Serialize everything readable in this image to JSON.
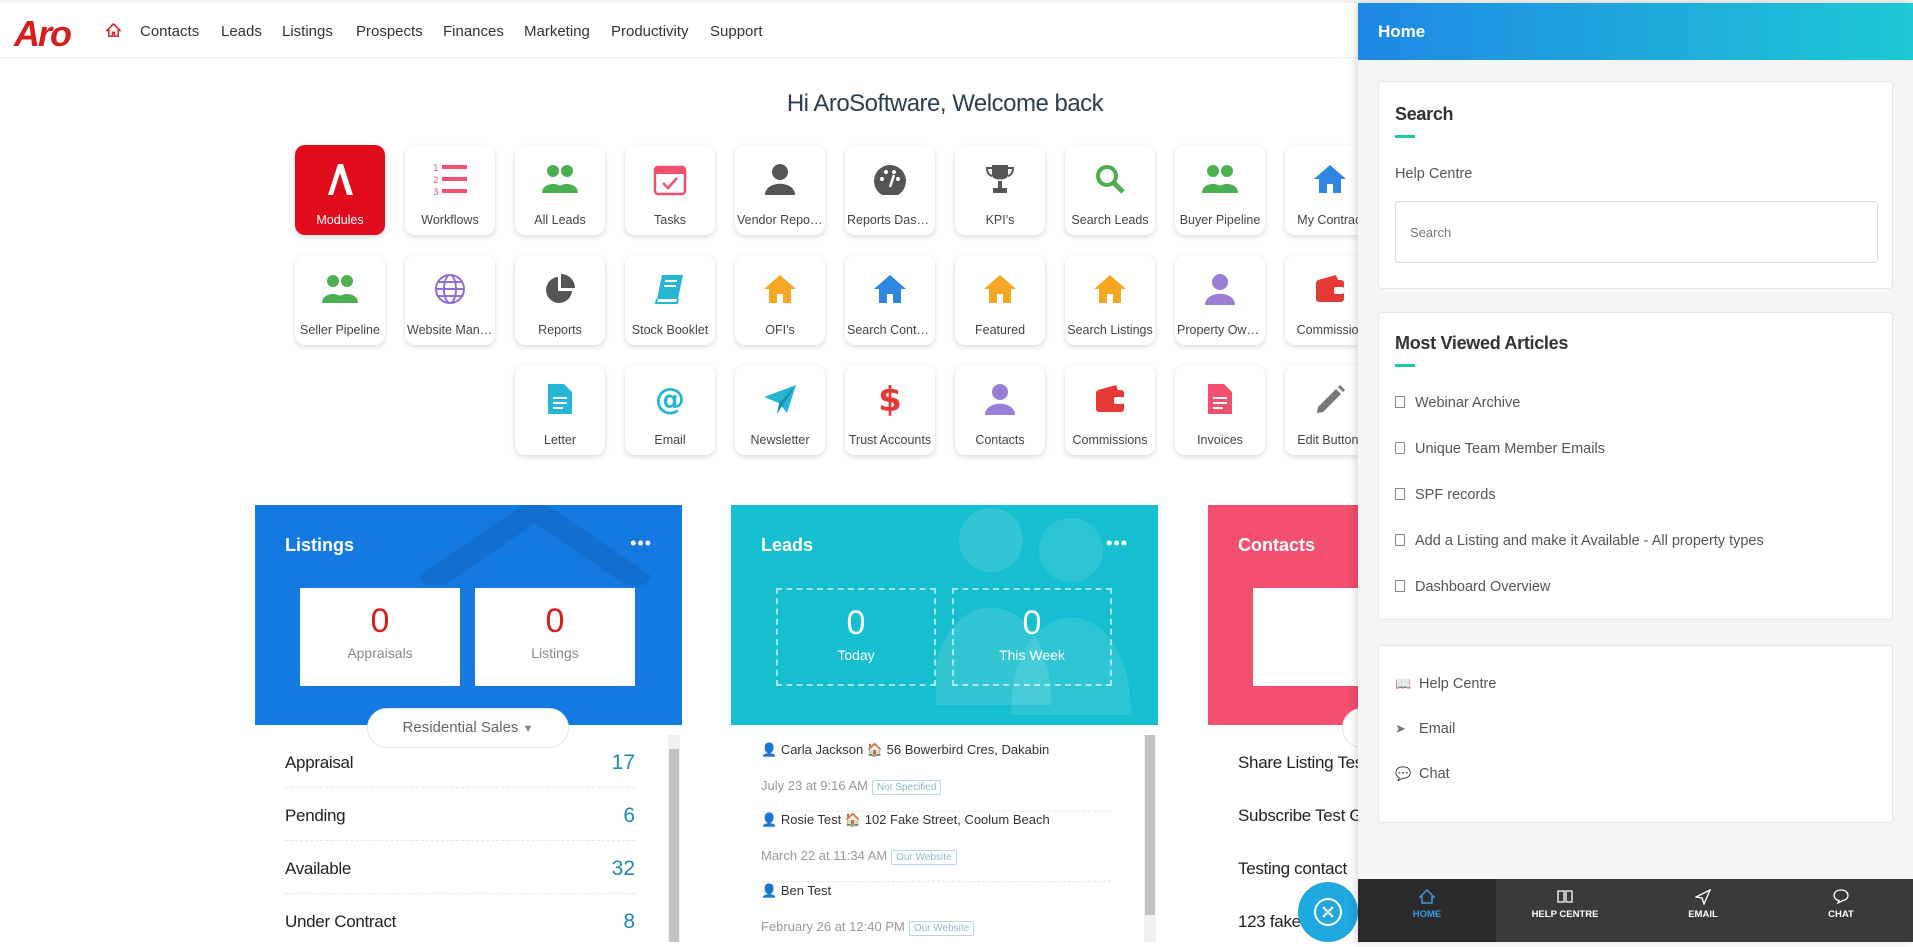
{
  "nav": {
    "logo": "Aro",
    "items": [
      "Contacts",
      "Leads",
      "Listings",
      "Prospects",
      "Finances",
      "Marketing",
      "Productivity",
      "Support"
    ]
  },
  "welcome": "Hi AroSoftware, Welcome back",
  "tiles": {
    "modules": "Modules",
    "workflows": "Workflows",
    "all_leads": "All Leads",
    "tasks": "Tasks",
    "vendor_reports": "Vendor Reports",
    "reports_dashboard": "Reports Dashb...",
    "kpis": "KPI's",
    "search_leads": "Search Leads",
    "buyer_pipeline": "Buyer Pipeline",
    "my_contracts": "My Contract",
    "seller_pipeline": "Seller Pipeline",
    "website_manager": "Website Mana...",
    "reports": "Reports",
    "stock_booklet": "Stock Booklet",
    "ofis": "OFI's",
    "search_contracts": "Search Contra...",
    "featured": "Featured",
    "search_listings": "Search Listings",
    "property_owners": "Property Owne...",
    "commission_top": "Commission",
    "letter": "Letter",
    "email": "Email",
    "newsletter": "Newsletter",
    "trust_accounts": "Trust Accounts",
    "contacts": "Contacts",
    "commissions": "Commissions",
    "invoices": "Invoices",
    "edit_buttons": "Edit Buttons"
  },
  "listings_card": {
    "title": "Listings",
    "dots": "•••",
    "appraisals_value": "0",
    "appraisals_label": "Appraisals",
    "listings_value": "0",
    "listings_label": "Listings",
    "filter": "Residential Sales",
    "rows": [
      {
        "label": "Appraisal",
        "value": "17"
      },
      {
        "label": "Pending",
        "value": "6"
      },
      {
        "label": "Available",
        "value": "32"
      },
      {
        "label": "Under Contract",
        "value": "8"
      }
    ]
  },
  "leads_card": {
    "title": "Leads",
    "dots": "•••",
    "today_value": "0",
    "today_label": "Today",
    "week_value": "0",
    "week_label": "This Week",
    "leads": [
      {
        "name": "Carla Jackson",
        "address": "56 Bowerbird Cres, Dakabin",
        "time": "July 23 at 9:16 AM",
        "tag": "Not Specified"
      },
      {
        "name": "Rosie Test",
        "address": "102 Fake Street, Coolum Beach",
        "time": "March 22 at 11:34 AM",
        "tag": "Our Website"
      },
      {
        "name": "Ben Test",
        "address": "",
        "time": "February 26 at 12:40 PM",
        "tag": "Our Website"
      }
    ]
  },
  "contacts_card": {
    "title": "Contacts",
    "rows": [
      "Share Listing Tes",
      "Subscribe Test G",
      "Testing contact",
      "123 fake"
    ]
  },
  "panel": {
    "title": "Home",
    "search_heading": "Search",
    "search_sub": "Help Centre",
    "search_placeholder": "Search",
    "articles_heading": "Most Viewed Articles",
    "articles": [
      "Webinar Archive",
      "Unique Team Member Emails",
      "SPF records",
      "Add a Listing and make it Available - All property types",
      "Dashboard Overview"
    ],
    "links": [
      "Help Centre",
      "Email",
      "Chat"
    ],
    "bottom_nav": [
      "HOME",
      "HELP CENTRE",
      "EMAIL",
      "CHAT"
    ]
  },
  "colors": {
    "brand_red": "#d51d1d",
    "listings_blue": "#1479e1",
    "leads_cyan": "#16bfd0",
    "contacts_pink": "#f2506e",
    "panel_gradient_start": "#1e88e5",
    "panel_gradient_end": "#1ec8d4"
  }
}
